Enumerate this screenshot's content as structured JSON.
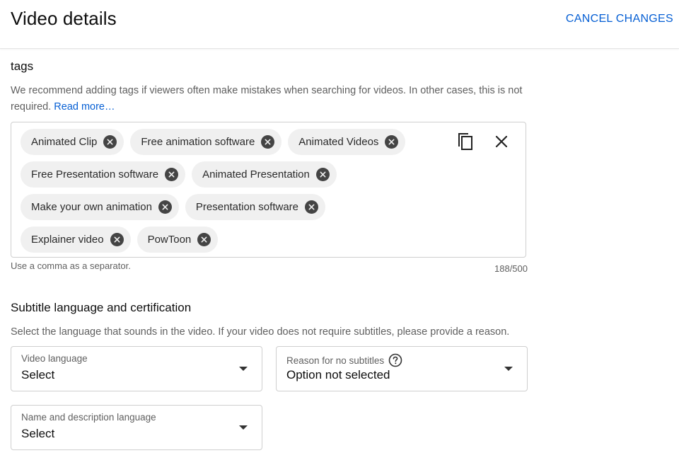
{
  "header": {
    "title": "Video details",
    "cancel_label": "CANCEL CHANGES"
  },
  "tags": {
    "title": "tags",
    "description": "We recommend adding tags if viewers often make mistakes when searching for videos. In other cases, this is not required.",
    "read_more": "Read more…",
    "chips": [
      "Animated Clip",
      "Free animation software",
      "Animated Videos",
      "Free Presentation software",
      "Animated Presentation",
      "Make your own animation",
      "Presentation software",
      "Explainer video",
      "PowToon"
    ],
    "hint": "Use a comma as a separator.",
    "counter": "188/500",
    "icons": {
      "copy": "copy-icon",
      "clear": "close-icon",
      "remove_chip": "close-circle-icon"
    }
  },
  "subtitles": {
    "title": "Subtitle language and certification",
    "description": "Select the language that sounds in the video. If your video does not require subtitles, please provide a reason.",
    "video_language": {
      "label": "Video language",
      "value": "Select"
    },
    "reason": {
      "label": "Reason for no subtitles",
      "value": "Option not selected"
    },
    "name_language": {
      "label": "Name and description language",
      "value": "Select"
    }
  },
  "colors": {
    "accent": "#065fd4",
    "chip_bg": "#f0f0f0",
    "border": "#cfcfcf"
  }
}
